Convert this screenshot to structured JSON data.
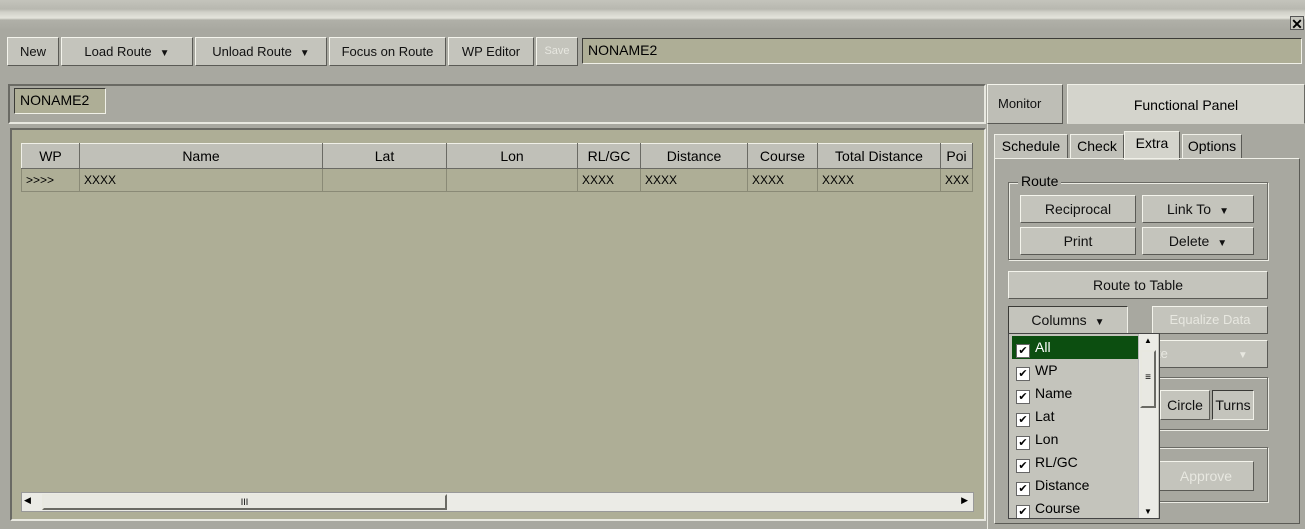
{
  "toolbar": {
    "new_label": "New",
    "load_route_label": "Load Route",
    "unload_route_label": "Unload Route",
    "focus_on_route_label": "Focus on Route",
    "wp_editor_label": "WP Editor",
    "save_label": "Save",
    "route_name_value": "NONAME2"
  },
  "route_header": {
    "name": "NONAME2"
  },
  "table": {
    "columns": [
      "WP",
      "Name",
      "Lat",
      "Lon",
      "RL/GC",
      "Distance",
      "Course",
      "Total Distance",
      "Poi"
    ],
    "rows": [
      [
        "&gt;&gt;&gt;&gt;",
        "XXXX",
        "",
        "",
        "XXXX",
        "XXXX",
        "XXXX",
        "XXXX",
        "XXX"
      ]
    ],
    "row_marker": ">>>>",
    "hscroll_grip": "III"
  },
  "panel_tabs": {
    "monitor": "Monitor",
    "functional_panel": "Functional Panel"
  },
  "sub_tabs": [
    "Schedule",
    "Check",
    "Extra",
    "Options"
  ],
  "extra": {
    "route_group_label": "Route",
    "reciprocal": "Reciprocal",
    "link_to": "Link To",
    "print": "Print",
    "delete": "Delete",
    "route_to_table": "Route to Table",
    "columns": "Columns",
    "equalize_data": "Equalize Data",
    "hidden_dropdown_text": "te",
    "circle": "Circle",
    "turns": "Turns",
    "approve": "Approve"
  },
  "columns_dropdown": {
    "items": [
      "All",
      "WP",
      "Name",
      "Lat",
      "Lon",
      "RL/GC",
      "Distance",
      "Course"
    ],
    "selected": "All"
  },
  "colors": {
    "background": "#a8a8a0",
    "field": "#aeae96",
    "button": "#c4c4bc",
    "selection": "#0c4e10"
  }
}
